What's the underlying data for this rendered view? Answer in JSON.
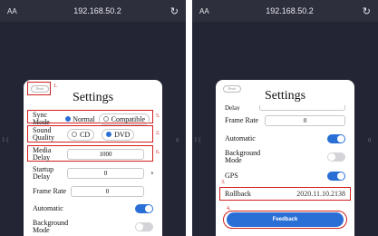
{
  "browser": {
    "aa": "AA",
    "url": "192.168.50.2",
    "reload_icon": "reload-icon"
  },
  "side_marks": {
    "left": "1 (",
    "right": "n"
  },
  "left_screen": {
    "reset": "Reset",
    "title": "Settings",
    "notes": {
      "n1": "1.",
      "n2": "2.",
      "n5": "5.",
      "n6": "6."
    },
    "sync_mode": {
      "label": "Sync Mode",
      "normal": "Normal",
      "compatible": "Compatible",
      "selected": "Normal"
    },
    "sound_quality": {
      "label": "Sound Quality",
      "cd": "CD",
      "dvd": "DVD",
      "selected": "DVD"
    },
    "media_delay": {
      "label": "Media Delay",
      "value": "1000"
    },
    "startup_delay": {
      "label": "Startup Delay",
      "value": "0",
      "unit": "s"
    },
    "frame_rate": {
      "label": "Frame Rate",
      "value": "0"
    },
    "automatic": {
      "label": "Automatic",
      "on": true
    },
    "background_mode": {
      "label": "Background Mode",
      "on": false
    }
  },
  "right_screen": {
    "reset": "Reset",
    "title": "Settings",
    "partial_label": "Delay",
    "frame_rate": {
      "label": "Frame Rate",
      "value": "0"
    },
    "automatic": {
      "label": "Automatic",
      "on": true
    },
    "background_mode": {
      "label": "Background Mode",
      "on": false
    },
    "gps": {
      "label": "GPS",
      "on": true
    },
    "notes": {
      "n3": "3.",
      "n4": "4."
    },
    "rollback": {
      "label": "Rollback",
      "value": "2020.11.10.2138"
    },
    "feedback": "Feedback"
  },
  "colors": {
    "accent": "#2a6fd6",
    "annotation": "#d11f1f",
    "background": "#232534"
  }
}
